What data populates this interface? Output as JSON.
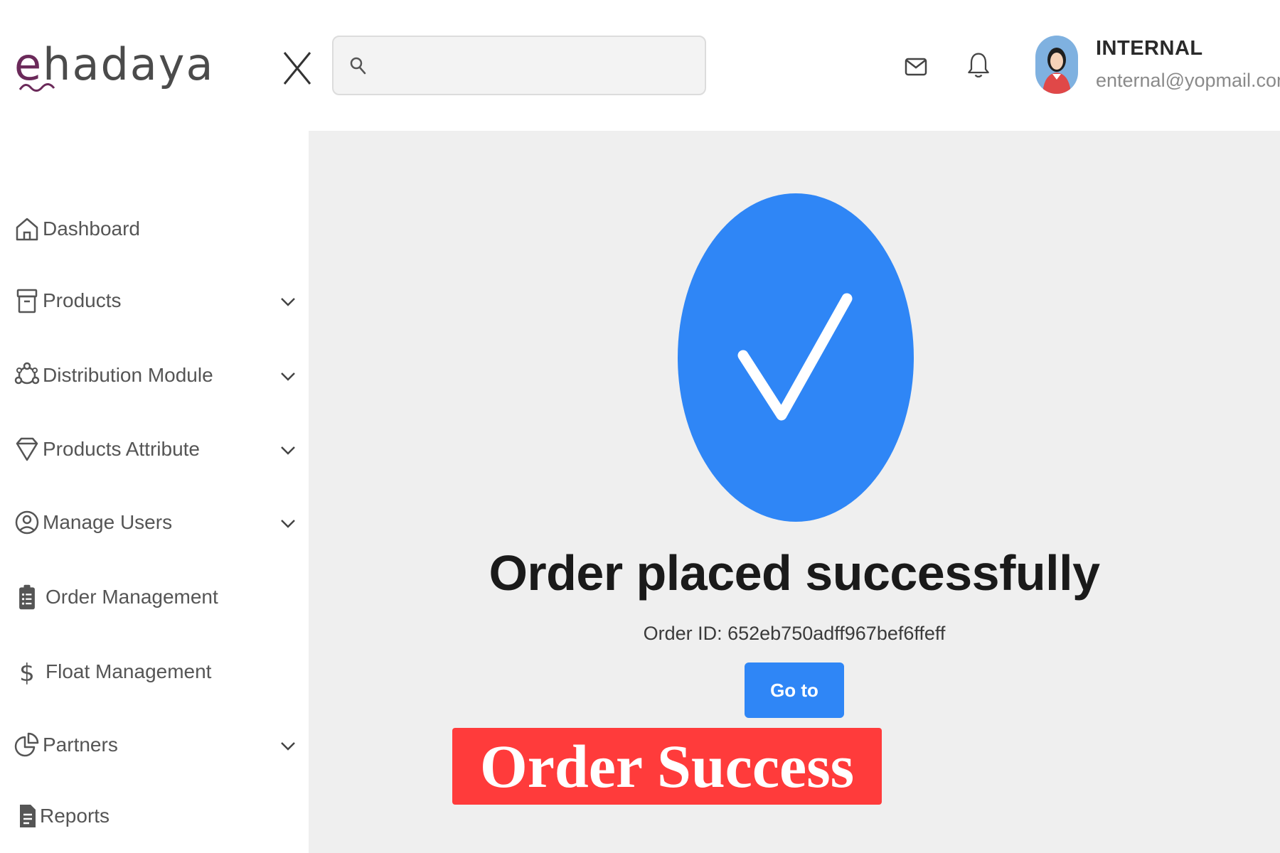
{
  "brand": {
    "logo_text": "ehadaya",
    "logo_letter_e": "e",
    "logo_rest": "hadaya",
    "accent_color": "#6b2a5a"
  },
  "header": {
    "close_icon": "close-icon",
    "search": {
      "placeholder": "",
      "value": "",
      "icon": "search-icon"
    },
    "mail_icon": "mail-icon",
    "bell_icon": "bell-icon",
    "user": {
      "name": "INTERNAL",
      "email": "enternal@yopmail.com",
      "avatar_icon": "avatar-icon"
    }
  },
  "sidebar": {
    "items": [
      {
        "label": "Dashboard",
        "icon": "home-icon",
        "has_chevron": false
      },
      {
        "label": "Products",
        "icon": "archive-icon",
        "has_chevron": true
      },
      {
        "label": "Distribution Module",
        "icon": "network-icon",
        "has_chevron": true
      },
      {
        "label": "Products Attribute",
        "icon": "diamond-icon",
        "has_chevron": true
      },
      {
        "label": "Manage Users",
        "icon": "user-circle-icon",
        "has_chevron": true
      },
      {
        "label": "Order Management",
        "icon": "clipboard-list-icon",
        "has_chevron": false
      },
      {
        "label": "Float Management",
        "icon": "dollar-icon",
        "has_chevron": false
      },
      {
        "label": "Partners",
        "icon": "pie-chart-icon",
        "has_chevron": true
      },
      {
        "label": "Reports",
        "icon": "file-icon",
        "has_chevron": false
      }
    ]
  },
  "main": {
    "success_icon": "check-icon",
    "success_color": "#2f86f6",
    "title": "Order placed successfully",
    "order_id": "Order ID: 652eb750adff967bef6ffeff",
    "home_button": "Go to Home"
  },
  "caption": {
    "text": "Order Success",
    "color": "#ff3b3b"
  }
}
